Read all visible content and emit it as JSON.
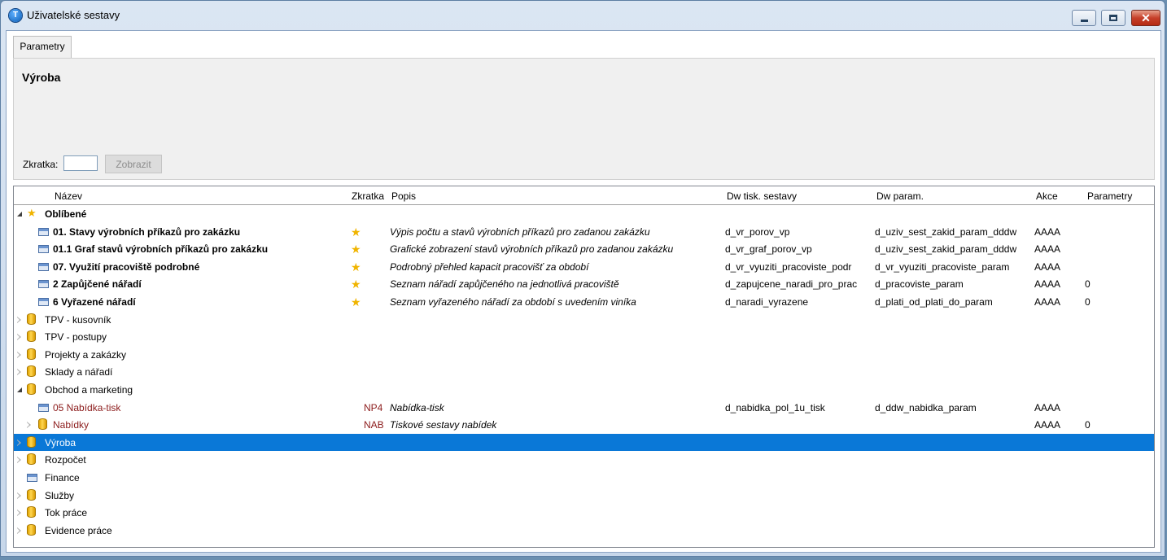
{
  "window": {
    "title": "Uživatelské sestavy",
    "app_icon_glyph": "T"
  },
  "tabs": [
    {
      "label": "Parametry",
      "active": true
    }
  ],
  "panel": {
    "heading": "Výroba",
    "shortcut_label": "Zkratka:",
    "shortcut_value": "",
    "show_button": "Zobrazit"
  },
  "columns": {
    "name": "Název",
    "shortcut": "Zkratka",
    "description": "Popis",
    "dw_print": "Dw tisk. sestavy",
    "dw_param": "Dw param.",
    "action": "Akce",
    "params": "Parametry"
  },
  "rows": [
    {
      "level": 0,
      "expander": "expanded",
      "icon": "star-icon",
      "name": "Oblíbené",
      "bold": true,
      "star": false,
      "shortcut": "",
      "description": "",
      "dw_print": "",
      "dw_param": "",
      "action": "",
      "params": ""
    },
    {
      "level": 1,
      "expander": "none",
      "icon": "report-icon",
      "name": "01. Stavy výrobních příkazů pro zakázku",
      "bold": true,
      "star": true,
      "shortcut": "",
      "description": "Výpis počtu a stavů výrobních příkazů pro zadanou zakázku",
      "dw_print": "d_vr_porov_vp",
      "dw_param": "d_uziv_sest_zakid_param_dddw",
      "action": "AAAA",
      "params": ""
    },
    {
      "level": 1,
      "expander": "none",
      "icon": "report-icon",
      "name": "01.1 Graf stavů výrobních příkazů pro zakázku",
      "bold": true,
      "star": true,
      "shortcut": "",
      "description": "Grafické zobrazení  stavů výrobních příkazů pro zadanou zakázku",
      "dw_print": "d_vr_graf_porov_vp",
      "dw_param": "d_uziv_sest_zakid_param_dddw",
      "action": "AAAA",
      "params": ""
    },
    {
      "level": 1,
      "expander": "none",
      "icon": "report-icon",
      "name": "07. Využití pracoviště podrobné",
      "bold": true,
      "star": true,
      "shortcut": "",
      "description": "Podrobný přehled kapacit pracovišť za období",
      "dw_print": "d_vr_vyuziti_pracoviste_podr",
      "dw_param": "d_vr_vyuziti_pracoviste_param",
      "action": "AAAA",
      "params": ""
    },
    {
      "level": 1,
      "expander": "none",
      "icon": "report-icon",
      "name": "2 Zapůjčené nářadí",
      "bold": true,
      "star": true,
      "shortcut": "",
      "description": "Seznam nářadí zapůjčeného na jednotlivá pracoviště",
      "dw_print": "d_zapujcene_naradi_pro_prac",
      "dw_param": "d_pracoviste_param",
      "action": "AAAA",
      "params": "0"
    },
    {
      "level": 1,
      "expander": "none",
      "icon": "report-icon",
      "name": "6 Vyřazené nářadí",
      "bold": true,
      "star": true,
      "shortcut": "",
      "description": "Seznam vyřazeného nářadí za období s uvedením viníka",
      "dw_print": "d_naradi_vyrazene",
      "dw_param": "d_plati_od_plati_do_param",
      "action": "AAAA",
      "params": "0"
    },
    {
      "level": 0,
      "expander": "collapsed",
      "icon": "database-icon",
      "name": "TPV - kusovník",
      "bold": false,
      "star": false,
      "shortcut": "",
      "description": "",
      "dw_print": "",
      "dw_param": "",
      "action": "",
      "params": ""
    },
    {
      "level": 0,
      "expander": "collapsed",
      "icon": "database-icon",
      "name": "TPV - postupy",
      "bold": false,
      "star": false,
      "shortcut": "",
      "description": "",
      "dw_print": "",
      "dw_param": "",
      "action": "",
      "params": ""
    },
    {
      "level": 0,
      "expander": "collapsed",
      "icon": "database-icon",
      "name": "Projekty a zakázky",
      "bold": false,
      "star": false,
      "shortcut": "",
      "description": "",
      "dw_print": "",
      "dw_param": "",
      "action": "",
      "params": ""
    },
    {
      "level": 0,
      "expander": "collapsed",
      "icon": "database-icon",
      "name": "Sklady a nářadí",
      "bold": false,
      "star": false,
      "shortcut": "",
      "description": "",
      "dw_print": "",
      "dw_param": "",
      "action": "",
      "params": ""
    },
    {
      "level": 0,
      "expander": "expanded",
      "icon": "database-icon",
      "name": "Obchod a marketing",
      "bold": false,
      "star": false,
      "shortcut": "",
      "description": "",
      "dw_print": "",
      "dw_param": "",
      "action": "",
      "params": ""
    },
    {
      "level": 1,
      "expander": "none",
      "icon": "report-icon",
      "name": "05 Nabídka-tisk",
      "bold": false,
      "red": true,
      "star": false,
      "shortcut": "NP4",
      "description": "Nabídka-tisk",
      "dw_print": "d_nabidka_pol_1u_tisk",
      "dw_param": "d_ddw_nabidka_param",
      "action": "AAAA",
      "params": ""
    },
    {
      "level": 1,
      "expander": "collapsed",
      "icon": "database-icon",
      "name": "Nabídky",
      "bold": false,
      "red": true,
      "star": false,
      "shortcut": "NAB",
      "description": "Tiskové sestavy nabídek",
      "dw_print": "",
      "dw_param": "",
      "action": "AAAA",
      "params": "0"
    },
    {
      "level": 0,
      "expander": "collapsed",
      "icon": "database-icon",
      "name": "Výroba",
      "bold": false,
      "selected": true,
      "star": false,
      "shortcut": "",
      "description": "",
      "dw_print": "",
      "dw_param": "",
      "action": "",
      "params": ""
    },
    {
      "level": 0,
      "expander": "collapsed",
      "icon": "database-icon",
      "name": "Rozpočet",
      "bold": false,
      "star": false,
      "shortcut": "",
      "description": "",
      "dw_print": "",
      "dw_param": "",
      "action": "",
      "params": ""
    },
    {
      "level": 0,
      "expander": "none",
      "icon": "report-icon",
      "name": "Finance",
      "bold": false,
      "star": false,
      "shortcut": "",
      "description": "",
      "dw_print": "",
      "dw_param": "",
      "action": "",
      "params": ""
    },
    {
      "level": 0,
      "expander": "collapsed",
      "icon": "database-icon",
      "name": "Služby",
      "bold": false,
      "star": false,
      "shortcut": "",
      "description": "",
      "dw_print": "",
      "dw_param": "",
      "action": "",
      "params": ""
    },
    {
      "level": 0,
      "expander": "collapsed",
      "icon": "database-icon",
      "name": "Tok práce",
      "bold": false,
      "star": false,
      "shortcut": "",
      "description": "",
      "dw_print": "",
      "dw_param": "",
      "action": "",
      "params": ""
    },
    {
      "level": 0,
      "expander": "collapsed",
      "icon": "database-icon",
      "name": "Evidence práce",
      "bold": false,
      "star": false,
      "shortcut": "",
      "description": "",
      "dw_print": "",
      "dw_param": "",
      "action": "",
      "params": ""
    }
  ],
  "colors": {
    "selection": "#0a78d7",
    "star": "#f0b400",
    "red_text": "#8b1a1a"
  }
}
